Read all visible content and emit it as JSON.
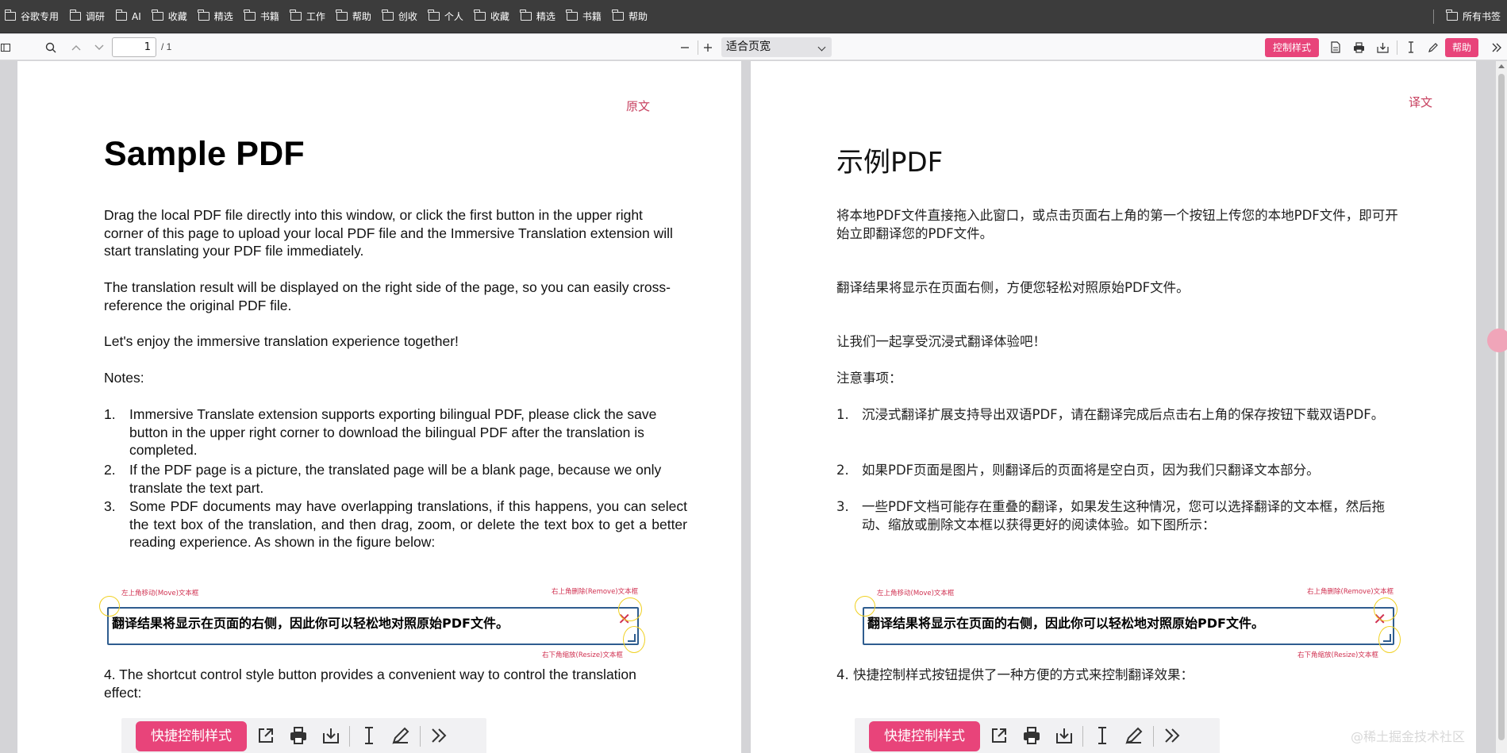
{
  "bookmarks": [
    {
      "label": "谷歌专用"
    },
    {
      "label": "调研"
    },
    {
      "label": "AI"
    },
    {
      "label": "收藏"
    },
    {
      "label": "精选"
    },
    {
      "label": "书籍"
    },
    {
      "label": "工作"
    },
    {
      "label": "帮助"
    },
    {
      "label": "创收"
    },
    {
      "label": "个人"
    },
    {
      "label": "收藏"
    },
    {
      "label": "精选"
    },
    {
      "label": "书籍"
    },
    {
      "label": "帮助"
    }
  ],
  "bookmarks_right": "所有书签",
  "toolbar": {
    "page_number": "1",
    "page_total": "/ 1",
    "zoom_label": "适合页宽",
    "control_style_label": "控制样式",
    "help_label": "帮助"
  },
  "left_page": {
    "corner_label": "原文",
    "title": "Sample PDF",
    "para1": "Drag the local PDF file directly into this window, or click the first button in the upper right corner of this page to upload your local PDF file and the Immersive Translation extension will start translating your PDF file immediately.",
    "para2": "The translation result will be displayed on the right side of the page, so you can easily cross-reference the original PDF file.",
    "para3": "Let's enjoy the immersive translation experience together!",
    "notes": "Notes:",
    "items": [
      {
        "num": "1.",
        "text": "Immersive Translate extension supports exporting bilingual PDF, please click the save button in the upper right corner to download the bilingual PDF after the translation is completed."
      },
      {
        "num": "2.",
        "text": "If the PDF page is a picture, the translated page will be a blank page, because we only translate the text part."
      },
      {
        "num": "3.",
        "text": "Some PDF documents may have overlapping translations, if this happens, you can select the text box of the translation, and then drag, zoom, or delete the text box to get a better reading experience. As shown in the figure below:"
      }
    ],
    "item4": "4.  The shortcut control style button provides a convenient way to control the translation effect:"
  },
  "right_page": {
    "corner_label": "译文",
    "title": "示例PDF",
    "para1": "将本地PDF文件直接拖入此窗口，或点击页面右上角的第一个按钮上传您的本地PDF文件，即可开始立即翻译您的PDF文件。",
    "para2": "翻译结果将显示在页面右侧，方便您轻松对照原始PDF文件。",
    "para3": "让我们一起享受沉浸式翻译体验吧！",
    "notes": "注意事项：",
    "items": [
      {
        "num": "1.",
        "text": "沉浸式翻译扩展支持导出双语PDF，请在翻译完成后点击右上角的保存按钮下载双语PDF。"
      },
      {
        "num": "2.",
        "text": "如果PDF页面是图片，则翻译后的页面将是空白页，因为我们只翻译文本部分。"
      },
      {
        "num": "3.",
        "text": "一些PDF文档可能存在重叠的翻译，如果发生这种情况，您可以选择翻译的文本框，然后拖动、缩放或删除文本框以获得更好的阅读体验。如下图所示："
      }
    ],
    "item4": "4. 快捷控制样式按钮提供了一种方便的方式来控制翻译效果："
  },
  "demo_figure": {
    "hint_move": "左上角移动(Move)文本框",
    "hint_remove": "右上角删除(Remove)文本框",
    "hint_resize": "右下角缩放(Resize)文本框",
    "box_text": "翻译结果将显示在页面的右侧，因此你可以轻松地对照原始PDF文件。",
    "close_glyph": "✕"
  },
  "control_bar": {
    "button_label": "快捷控制样式"
  },
  "watermark": "@稀土掘金技术社区",
  "colors": {
    "accent_pink": "#e8447a",
    "corner_label": "#c7405f",
    "bookmark_bar": "#3c3c3c"
  }
}
